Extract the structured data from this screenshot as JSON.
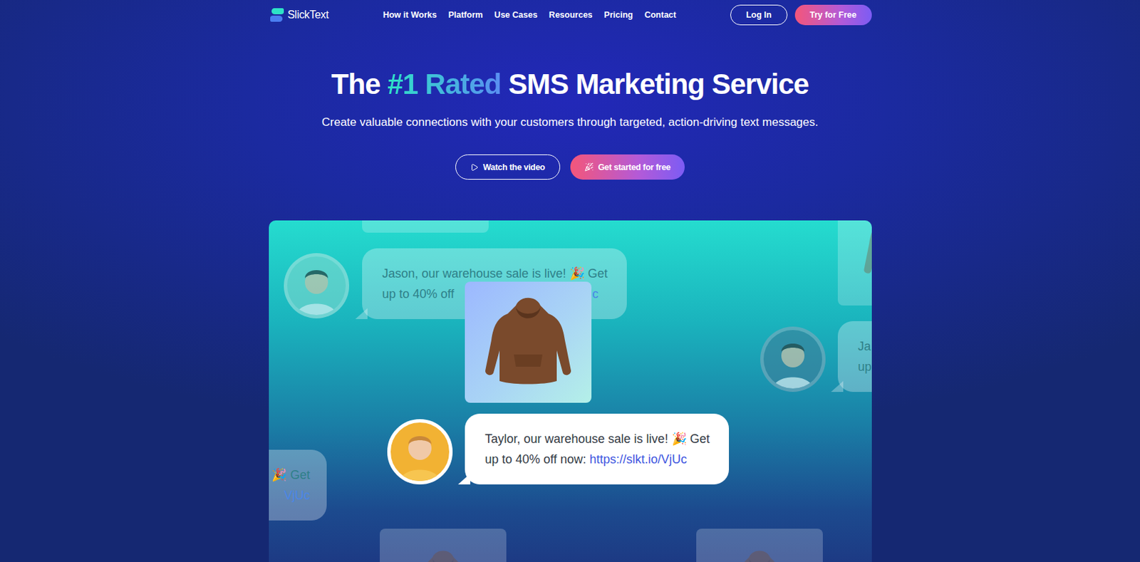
{
  "brand": {
    "name": "SlickText"
  },
  "nav": {
    "links": [
      "How it Works",
      "Platform",
      "Use Cases",
      "Resources",
      "Pricing",
      "Contact"
    ],
    "login": "Log In",
    "cta": "Try for Free"
  },
  "hero": {
    "title_before": "The ",
    "title_highlight": "#1 Rated",
    "title_after": " SMS Marketing Service",
    "subtitle": "Create valuable connections with your customers through targeted, action-driving text messages.",
    "buttons": [
      {
        "label": "Watch the video",
        "kind": "outline"
      },
      {
        "label": "Get started for free",
        "kind": "primary"
      }
    ]
  },
  "showcase": {
    "messages": [
      {
        "faded": true,
        "covered": true,
        "avatar": {
          "color": "#7fd9cf"
        },
        "lines": [
          {
            "text": "Jason, our warehouse sale is live! 🎉 Get"
          },
          {
            "text": "up to 40% off",
            "link": "Uc"
          }
        ]
      },
      {
        "faded": false,
        "covered": false,
        "avatar": {
          "color": "#f2b233"
        },
        "lines": [
          {
            "text": "Taylor, our warehouse sale is live! 🎉 Get"
          },
          {
            "text": "up to 40% off now: ",
            "link": "https://slkt.io/VjUc"
          }
        ]
      },
      {
        "faded": true,
        "covered": false,
        "avatar": {
          "color": "#3f7f9a"
        },
        "lines": [
          {
            "text": "Ja"
          },
          {
            "text": "up"
          }
        ]
      },
      {
        "faded": true,
        "covered": false,
        "lines": [
          {
            "text": "🎉 Get"
          },
          {
            "link": "VjUc"
          }
        ]
      }
    ]
  }
}
